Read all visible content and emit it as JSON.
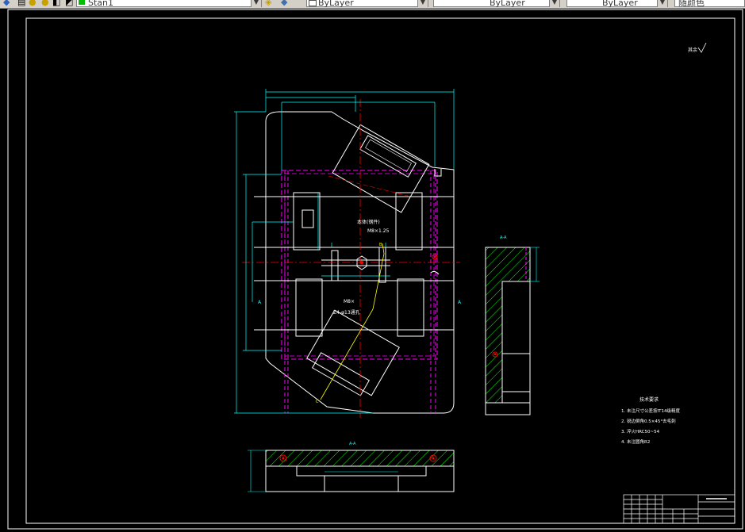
{
  "app": {
    "toolbar": {
      "text_style": "Stan1",
      "color_combo": "ByLayer",
      "linetype_combo": "ByLayer",
      "lineweight_combo": "ByLayer",
      "plotstyle_combo": "随颜色"
    }
  },
  "drawing": {
    "roughness_mark": "其余",
    "part_label_line1": "本体(钢件)",
    "part_label_line2": "M8×1.25",
    "part_label_line3": "M8×",
    "part_label_line4": "Z4-φ13通孔",
    "notes_title": "技术要求",
    "notes": [
      "1. 未注尺寸公差按IT14级精度",
      "2. 锐边倒角0.5×45°去毛刺",
      "3. 淬火HRC50~54",
      "4. 未注圆角R2"
    ],
    "section_marker": "A-A",
    "view_marker": "A"
  },
  "colors": {
    "background": "#000000",
    "frame": "#ffffff",
    "dimension": "#00ffff",
    "hidden": "#ff00ff",
    "centerline": "#ff0000",
    "hatch": "#00ff00",
    "construction": "#ffff00"
  }
}
